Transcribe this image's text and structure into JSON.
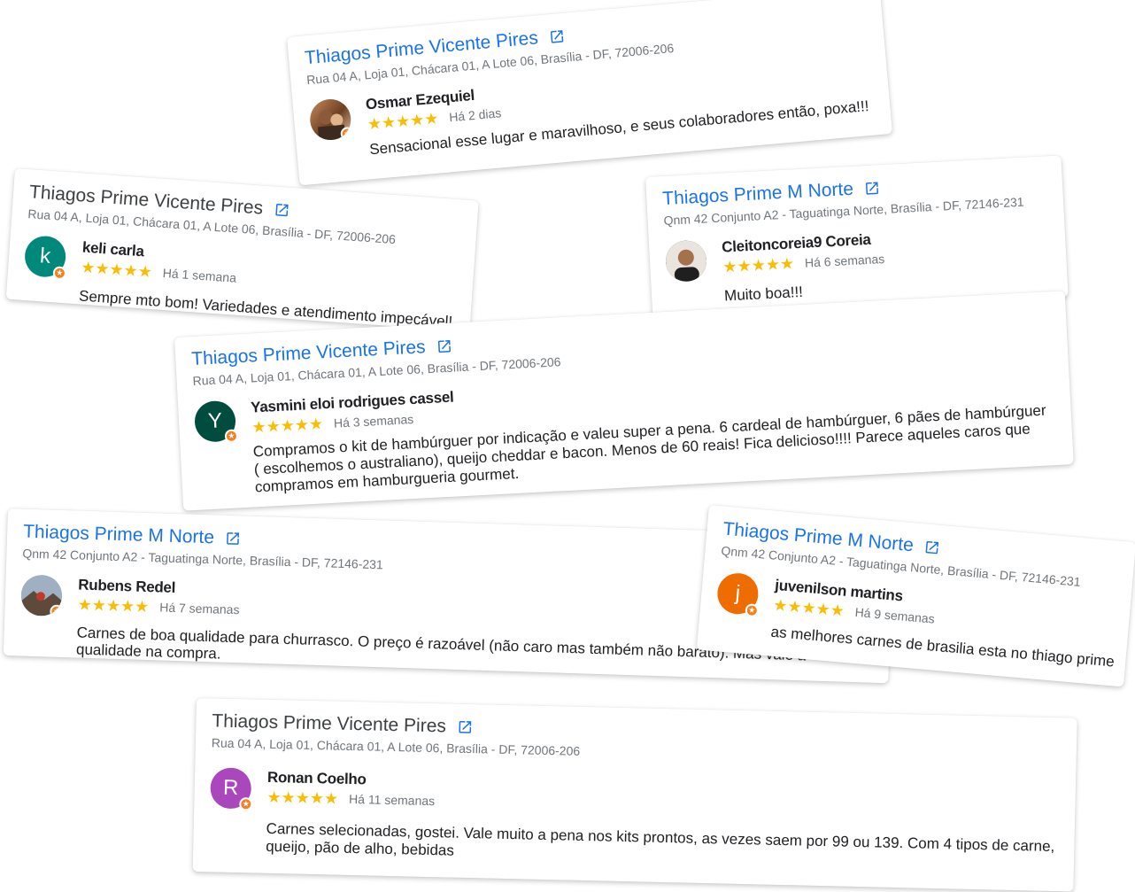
{
  "colors": {
    "link_blue": "#1a73e8",
    "star_gold": "#fbbc04",
    "badge_orange": "#f4811f"
  },
  "icons": {
    "external_link": "open-in-new-icon",
    "star": "star-icon",
    "local_guide": "local-guide-badge-icon"
  },
  "reviews": [
    {
      "business": "Thiagos Prime Vicente Pires",
      "address": "Rua 04 A, Loja 01, Chácara 01, A Lote 06, Brasília - DF, 72006-206",
      "reviewer": "Osmar Ezequiel",
      "stars": "★★★★★",
      "time": "Há 2 dias",
      "text": "Sensacional esse lugar e maravilhoso, e seus colaboradores então, poxa!!!"
    },
    {
      "business": "Thiagos Prime Vicente Pires",
      "address": "Rua 04 A, Loja 01, Chácara 01, A Lote 06, Brasília - DF, 72006-206",
      "reviewer": "keli carla",
      "initial": "k",
      "avatar_color": "#00897b",
      "stars": "★★★★★",
      "time": "Há 1 semana",
      "text": "Sempre mto bom! Variedades e atendimento impecável!"
    },
    {
      "business": "Thiagos Prime M Norte",
      "address": "Qnm 42 Conjunto A2 - Taguatinga Norte, Brasília - DF, 72146-231",
      "reviewer": "Cleitoncoreia9 Coreia",
      "stars": "★★★★★",
      "time": "Há 6 semanas",
      "text": "Muito boa!!!"
    },
    {
      "business": "Thiagos Prime Vicente Pires",
      "address": "Rua 04 A, Loja 01, Chácara 01, A Lote 06, Brasília - DF, 72006-206",
      "reviewer": "Yasmini eloi rodrigues cassel",
      "initial": "Y",
      "avatar_color": "#004d40",
      "stars": "★★★★★",
      "time": "Há 3 semanas",
      "text": "Compramos o kit de hambúrguer por indicação e valeu super a pena. 6 cardeal de hambúrguer, 6 pães de hambúrguer ( escolhemos o australiano), queijo cheddar e bacon. Menos de 60 reais! Fica delicioso!!!! Parece aqueles caros que compramos em hamburgueria gourmet."
    },
    {
      "business": "Thiagos Prime M Norte",
      "address": "Qnm 42 Conjunto A2 - Taguatinga Norte, Brasília - DF, 72146-231",
      "reviewer": "Rubens Redel",
      "stars": "★★★★★",
      "time": "Há 7 semanas",
      "text": "Carnes de boa qualidade para churrasco. O preço é razoável (não caro mas também não barato). Mas vale a qualidade na compra."
    },
    {
      "business": "Thiagos Prime M Norte",
      "address": "Qnm 42 Conjunto A2 - Taguatinga Norte, Brasília - DF, 72146-231",
      "reviewer": "juvenilson martins",
      "initial": "j",
      "avatar_color": "#ef6c00",
      "stars": "★★★★★",
      "time": "Há 9 semanas",
      "text": "as melhores carnes de brasilia esta no thiago prime"
    },
    {
      "business": "Thiagos Prime Vicente Pires",
      "address": "Rua 04 A, Loja 01, Chácara 01, A Lote 06, Brasília - DF, 72006-206",
      "reviewer": "Ronan Coelho",
      "initial": "R",
      "avatar_color": "#ab47bc",
      "stars": "★★★★★",
      "time": "Há 11 semanas",
      "text": "Carnes selecionadas, gostei. Vale muito a pena nos kits prontos, as vezes saem por 99 ou 139. Com 4 tipos de carne, queijo, pão de alho, bebidas"
    }
  ]
}
